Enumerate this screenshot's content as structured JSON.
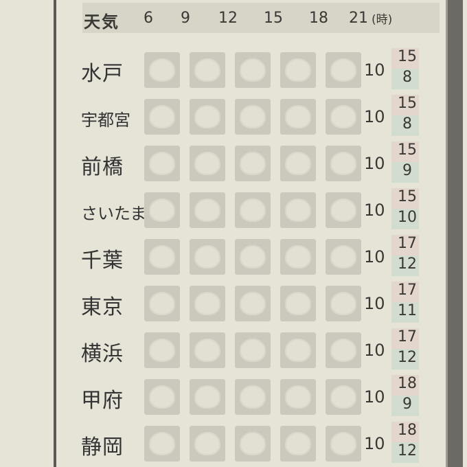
{
  "header": {
    "title": "天気",
    "hours": [
      "6",
      "9",
      "12",
      "15",
      "18",
      "21"
    ],
    "hour_unit": "(時)"
  },
  "rows": [
    {
      "city": "水戸",
      "precip": "10",
      "high": "15",
      "low": "8"
    },
    {
      "city": "宇都宮",
      "precip": "10",
      "high": "15",
      "low": "8"
    },
    {
      "city": "前橋",
      "precip": "10",
      "high": "15",
      "low": "9"
    },
    {
      "city": "さいたま",
      "precip": "10",
      "high": "15",
      "low": "10"
    },
    {
      "city": "千葉",
      "precip": "10",
      "high": "17",
      "low": "12"
    },
    {
      "city": "東京",
      "precip": "10",
      "high": "17",
      "low": "11"
    },
    {
      "city": "横浜",
      "precip": "10",
      "high": "17",
      "low": "12"
    },
    {
      "city": "甲府",
      "precip": "10",
      "high": "18",
      "low": "9"
    },
    {
      "city": "静岡",
      "precip": "10",
      "high": "18",
      "low": "12"
    }
  ],
  "weather_icon": "cloud-icon",
  "colors": {
    "background": "#e6e3d7",
    "high_temp_tint": "#e3d6cd",
    "low_temp_tint": "#d2dccf"
  }
}
